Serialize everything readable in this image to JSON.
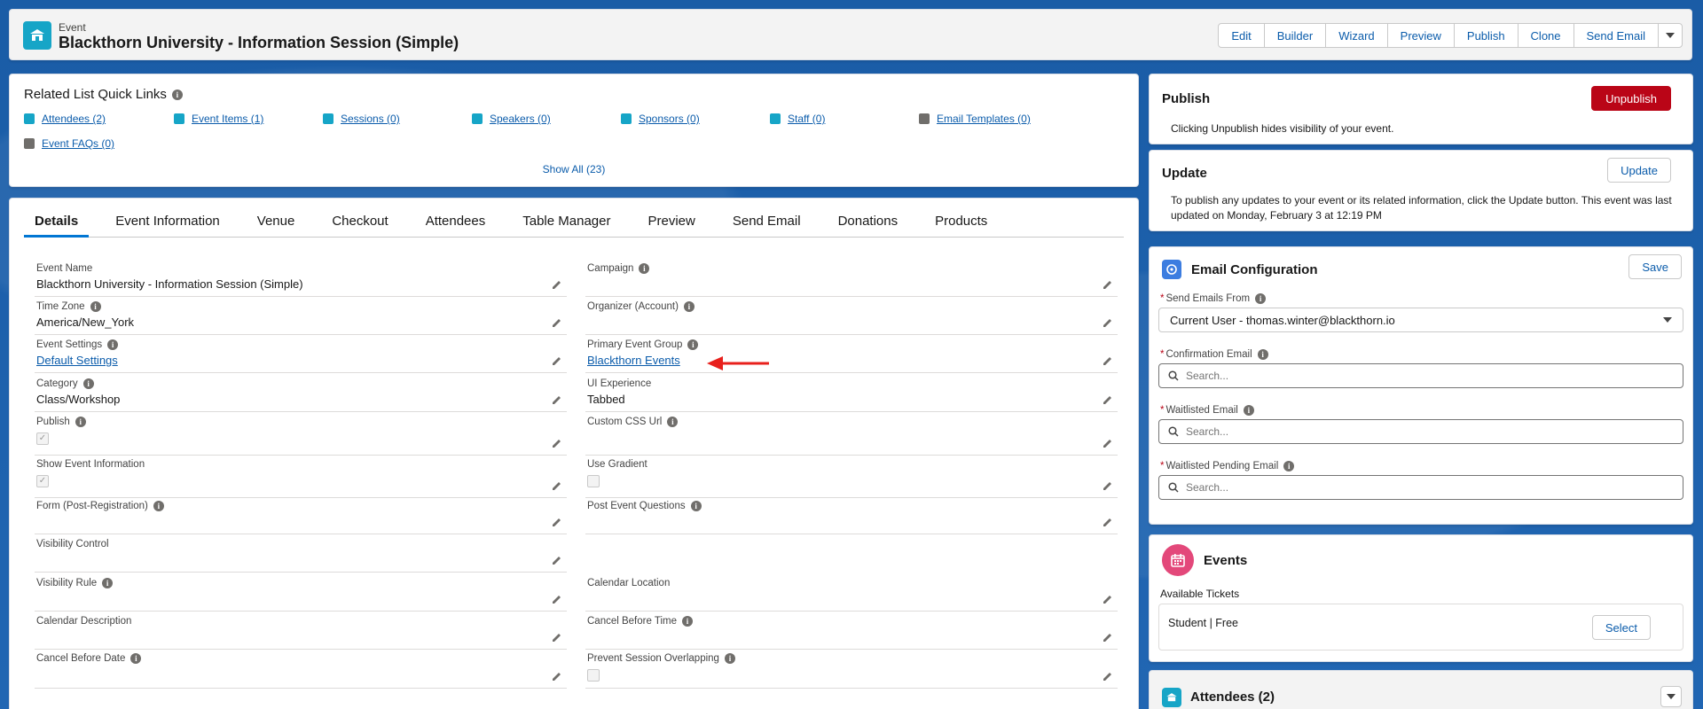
{
  "header": {
    "object_type": "Event",
    "title": "Blackthorn University - Information Session (Simple)",
    "actions": [
      "Edit",
      "Builder",
      "Wizard",
      "Preview",
      "Publish",
      "Clone",
      "Send Email"
    ]
  },
  "quick_links": {
    "title": "Related List Quick Links",
    "items": [
      {
        "label": "Attendees (2)",
        "color": "#16a5c7"
      },
      {
        "label": "Event Items (1)",
        "color": "#16a5c7"
      },
      {
        "label": "Sessions (0)",
        "color": "#16a5c7"
      },
      {
        "label": "Speakers (0)",
        "color": "#16a5c7"
      },
      {
        "label": "Sponsors (0)",
        "color": "#16a5c7"
      },
      {
        "label": "Staff (0)",
        "color": "#16a5c7"
      },
      {
        "label": "Email Templates (0)",
        "color": "#706e6b"
      },
      {
        "label": "Event FAQs (0)",
        "color": "#706e6b"
      }
    ],
    "show_all": "Show All (23)"
  },
  "tabs": [
    "Details",
    "Event Information",
    "Venue",
    "Checkout",
    "Attendees",
    "Table Manager",
    "Preview",
    "Send Email",
    "Donations",
    "Products"
  ],
  "fields_left": {
    "event_name": {
      "label": "Event Name",
      "value": "Blackthorn University - Information Session (Simple)"
    },
    "time_zone": {
      "label": "Time Zone",
      "value": "America/New_York"
    },
    "event_settings": {
      "label": "Event Settings",
      "value": "Default Settings"
    },
    "category": {
      "label": "Category",
      "value": "Class/Workshop"
    },
    "publish": {
      "label": "Publish",
      "checked": true
    },
    "show_event_info": {
      "label": "Show Event Information",
      "checked": true
    },
    "form_post_reg": {
      "label": "Form (Post-Registration)",
      "value": ""
    },
    "visibility_control": {
      "label": "Visibility Control",
      "value": ""
    },
    "visibility_rule": {
      "label": "Visibility Rule",
      "value": ""
    },
    "calendar_description": {
      "label": "Calendar Description",
      "value": ""
    },
    "cancel_before_date": {
      "label": "Cancel Before Date",
      "value": ""
    }
  },
  "fields_right": {
    "campaign": {
      "label": "Campaign",
      "value": ""
    },
    "organizer": {
      "label": "Organizer (Account)",
      "value": ""
    },
    "primary_event_group": {
      "label": "Primary Event Group",
      "value": "Blackthorn Events"
    },
    "ui_experience": {
      "label": "UI Experience",
      "value": "Tabbed"
    },
    "custom_css_url": {
      "label": "Custom CSS Url",
      "value": ""
    },
    "use_gradient": {
      "label": "Use Gradient",
      "checked": false
    },
    "post_event_questions": {
      "label": "Post Event Questions",
      "value": ""
    },
    "calendar_location": {
      "label": "Calendar Location",
      "value": ""
    },
    "cancel_before_time": {
      "label": "Cancel Before Time",
      "value": ""
    },
    "prevent_session_overlapping": {
      "label": "Prevent Session Overlapping",
      "checked": false
    }
  },
  "publish_panel": {
    "title": "Publish",
    "button": "Unpublish",
    "text": "Clicking Unpublish hides visibility of your event."
  },
  "update_panel": {
    "title": "Update",
    "button": "Update",
    "text": "To publish any updates to your event or its related information, click the Update button. This event was last updated on Monday, February 3 at 12:19 PM"
  },
  "email_config": {
    "title": "Email Configuration",
    "save": "Save",
    "send_from": {
      "label": "Send Emails From",
      "value": "Current User - thomas.winter@blackthorn.io"
    },
    "confirmation": {
      "label": "Confirmation Email",
      "placeholder": "Search..."
    },
    "waitlisted": {
      "label": "Waitlisted Email",
      "placeholder": "Search..."
    },
    "waitlisted_pending": {
      "label": "Waitlisted Pending Email",
      "placeholder": "Search..."
    }
  },
  "events_panel": {
    "title": "Events",
    "available": "Available Tickets",
    "ticket": "Student | Free",
    "select": "Select"
  },
  "attendees_panel": {
    "title": "Attendees (2)"
  },
  "colors": {
    "brand_blue": "#0b5cab",
    "accent_blue": "#0176d3",
    "danger": "#ba0517",
    "event_icon": "#16a5c7",
    "events_pink": "#e3487a",
    "arrow_red": "#e8201c"
  }
}
